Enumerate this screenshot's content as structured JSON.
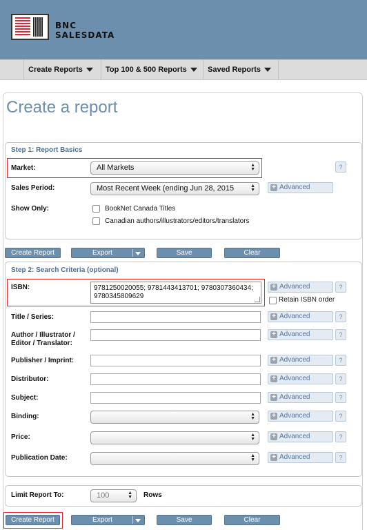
{
  "brand": {
    "line1": "BNC",
    "line2": "SALESDATA",
    "logo_icon": "book-barcode-icon"
  },
  "nav": [
    {
      "label": "Create Reports"
    },
    {
      "label": "Top 100 & 500 Reports"
    },
    {
      "label": "Saved Reports"
    }
  ],
  "page_title": "Create a report",
  "step1": {
    "title": "Step 1: Report Basics",
    "market_label": "Market:",
    "market_value": "All Markets",
    "period_label": "Sales Period:",
    "period_value": "Most Recent Week (ending Jun 28, 2015",
    "show_only_label": "Show Only:",
    "show_only_options": [
      "BookNet Canada Titles",
      "Canadian authors/illustrators/editors/translators"
    ]
  },
  "actions": {
    "create": "Create Report",
    "export": "Export",
    "save": "Save",
    "clear": "Clear"
  },
  "step2": {
    "title": "Step 2: Search Criteria (optional)",
    "isbn_label": "ISBN:",
    "isbn_value": "9781250020055; 9781443413701; 9780307360434; 9780345809629",
    "retain_label": "Retain ISBN order",
    "fields": {
      "title_series": "Title / Series:",
      "author": "Author / Illustrator / Editor / Translator:",
      "publisher": "Publisher / Imprint:",
      "distributor": "Distributor:",
      "subject": "Subject:",
      "binding": "Binding:",
      "price": "Price:",
      "pub_date": "Publication Date:"
    }
  },
  "advanced_label": "Advanced",
  "help_label": "?",
  "limit": {
    "label": "Limit Report To:",
    "value": "100",
    "unit": "Rows"
  },
  "colors": {
    "header": "#6d8fae",
    "title": "#6b8eb0",
    "highlight": "#e0252a",
    "button": "#6d8fae"
  }
}
